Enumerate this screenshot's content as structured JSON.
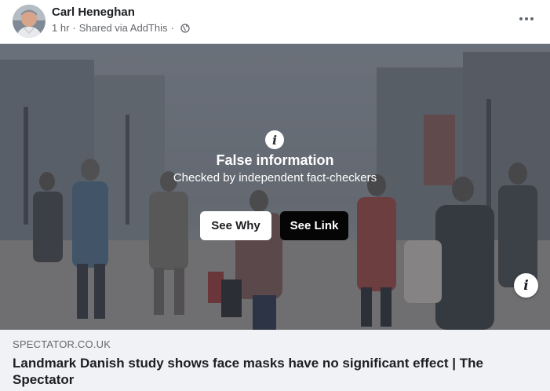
{
  "post": {
    "author_name": "Carl Heneghan",
    "time": "1 hr",
    "separator": "·",
    "shared_via": "Shared via AddThis",
    "privacy_icon": "globe-icon",
    "more_icon": "more-horizontal-icon"
  },
  "fact_check": {
    "icon": "info-icon",
    "title": "False information",
    "subtitle": "Checked by independent fact-checkers",
    "see_why_label": "See Why",
    "see_link_label": "See Link"
  },
  "link_preview": {
    "domain": "SPECTATOR.CO.UK",
    "title": "Landmark Danish study shows face masks have no significant effect | The Spectator",
    "info_icon": "info-icon"
  }
}
